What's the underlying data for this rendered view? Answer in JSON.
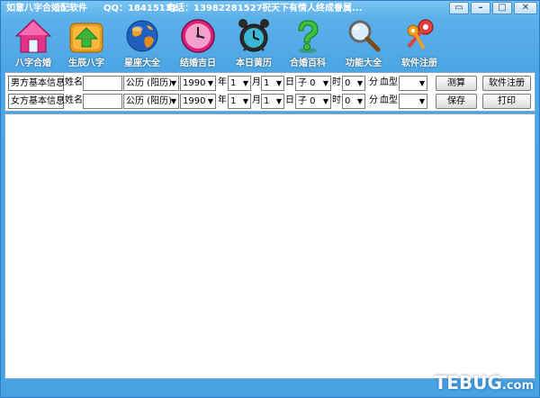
{
  "titlebar": {
    "app_name": "如意八字合婚配软件",
    "qq": "QQ：18415132",
    "phone": "电话：13982281527",
    "slogan": "祝天下有情人终成眷属..."
  },
  "toolbar": [
    {
      "label": "八字合婚",
      "icon": "house-icon"
    },
    {
      "label": "生辰八字",
      "icon": "home-up-arrow-icon"
    },
    {
      "label": "星座大全",
      "icon": "globe-icon"
    },
    {
      "label": "结婚吉日",
      "icon": "clock-icon"
    },
    {
      "label": "本日黄历",
      "icon": "alarm-clock-icon"
    },
    {
      "label": "合婚百科",
      "icon": "question-mark-icon"
    },
    {
      "label": "功能大全",
      "icon": "magnifier-icon"
    },
    {
      "label": "软件注册",
      "icon": "keys-icon"
    }
  ],
  "form": {
    "male": {
      "group_label": "男方基本信息",
      "name_label": "姓名",
      "name_value": "",
      "calendar": "公历 (阳历)",
      "year": "1990",
      "year_unit": "年",
      "month": "1",
      "month_unit": "月",
      "day": "1",
      "day_unit": "日",
      "hour": "子 0",
      "hour_unit": "时",
      "minute": "0",
      "minute_unit": "分",
      "blood_label": "血型",
      "blood_value": "",
      "btn1": "测算",
      "btn2": "软件注册"
    },
    "female": {
      "group_label": "女方基本信息",
      "name_label": "姓名",
      "name_value": "",
      "calendar": "公历 (阳历)",
      "year": "1990",
      "year_unit": "年",
      "month": "1",
      "month_unit": "月",
      "day": "1",
      "day_unit": "日",
      "hour": "子 0",
      "hour_unit": "时",
      "minute": "0",
      "minute_unit": "分",
      "blood_label": "血型",
      "blood_value": "",
      "btn1": "保存",
      "btn2": "打印"
    }
  },
  "watermark": {
    "main": "TEBUG",
    "suffix": ".com"
  },
  "colors": {
    "frame": "#4ba5e4",
    "panel": "#ffffff"
  }
}
